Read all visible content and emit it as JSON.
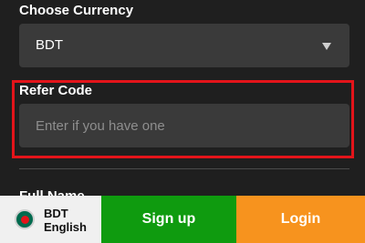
{
  "currency": {
    "label": "Choose Currency",
    "selected": "BDT"
  },
  "refer": {
    "label": "Refer Code",
    "placeholder": "Enter if you have one",
    "value": ""
  },
  "next_section_peek": "Full Name",
  "bottom_bar": {
    "language": {
      "currency": "BDT",
      "language": "English",
      "flag_icon": "bangladesh-flag-icon"
    },
    "signup_label": "Sign up",
    "login_label": "Login"
  },
  "colors": {
    "background": "#1f1f1f",
    "input_background": "#3a3a3a",
    "highlight_border": "#e3141a",
    "signup": "#0f9b0f",
    "login": "#f7931e",
    "language_button": "#f0f0f0"
  }
}
